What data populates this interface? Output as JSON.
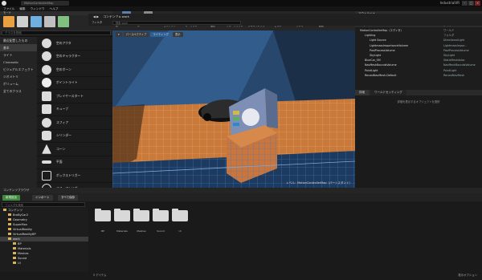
{
  "window": {
    "tab_label": "MotionControllerMap",
    "app_title": "IndustrialVR",
    "min_label": "–",
    "max_label": "□",
    "close_label": "×"
  },
  "menu": [
    "ファイル",
    "編集",
    "ウィンドウ",
    "ヘルプ"
  ],
  "modes": {
    "header": "モード",
    "search_placeholder": "クラスを検索",
    "colors": [
      "#e8a040",
      "#d0d0d0",
      "#6fb0e0",
      "#c0c0c0",
      "#80c080"
    ]
  },
  "place": {
    "categories": [
      {
        "label": "最近配置したもの",
        "selected": false
      },
      {
        "label": "基本",
        "selected": true
      },
      {
        "label": "ライト",
        "selected": false
      },
      {
        "label": "Cinematic",
        "selected": false
      },
      {
        "label": "ビジュアルエフェクト",
        "selected": false
      },
      {
        "label": "ジオメトリ",
        "selected": false
      },
      {
        "label": "ボリューム",
        "selected": false
      },
      {
        "label": "全てのクラス",
        "selected": false
      }
    ],
    "items": [
      {
        "label": "空のアクタ",
        "shape": "circle"
      },
      {
        "label": "空のキャラクター",
        "shape": "circle"
      },
      {
        "label": "空のポーン",
        "shape": "circle"
      },
      {
        "label": "ポイントライト",
        "shape": "circle"
      },
      {
        "label": "プレイヤースタート",
        "shape": "square"
      },
      {
        "label": "キューブ",
        "shape": "square"
      },
      {
        "label": "スフィア",
        "shape": "circle"
      },
      {
        "label": "シリンダー",
        "shape": "square"
      },
      {
        "label": "コーン",
        "shape": "square"
      },
      {
        "label": "平面",
        "shape": "square"
      },
      {
        "label": "ボックストリガー",
        "shape": "square"
      },
      {
        "label": "スフィアトリガー",
        "shape": "circle"
      }
    ]
  },
  "toolbar": [
    {
      "label": "現在のレベルを保存",
      "color": "#5a7fb0"
    },
    {
      "label": "ソースコントロール",
      "color": "#8a8a8a"
    },
    {
      "label": "コンテンツ",
      "color": "#5a7fb0"
    },
    {
      "label": "マーケット",
      "color": "#b07a30"
    },
    {
      "label": "設定",
      "color": "#8a8a8a"
    },
    {
      "label": "ブループリント",
      "color": "#4a78c0"
    },
    {
      "label": "シネマティクス",
      "color": "#707070"
    },
    {
      "label": "ビルド",
      "color": "#8a8a8a"
    },
    {
      "label": "プレイ",
      "color": "#3aa050"
    },
    {
      "label": "起動",
      "color": "#707070"
    }
  ],
  "viewport": {
    "perspective_label": "パースペクティブ",
    "lit_label": "ライティング",
    "show_label": "表示",
    "level_label": "レベル：MotionControllerMap（パーシスタント）"
  },
  "outliner": {
    "header": "アウトライナ",
    "search_placeholder": "検索",
    "col_label": "ラベル",
    "col_type": "タイプ",
    "rows": [
      {
        "name": "MotionControllerMap（エディタ）",
        "type": "ワールド",
        "selected": false,
        "indent": 0
      },
      {
        "name": "Lighting",
        "type": "フォルダ",
        "selected": false,
        "indent": 1
      },
      {
        "name": "Light Source",
        "type": "DirectionalLight",
        "selected": false,
        "indent": 2
      },
      {
        "name": "LightmassImportanceVolume",
        "type": "LightmassImpor...",
        "selected": false,
        "indent": 2
      },
      {
        "name": "PostProcessVolume",
        "type": "PostProcessVolume",
        "selected": false,
        "indent": 2
      },
      {
        "name": "SkyLight",
        "type": "SkyLight",
        "selected": false,
        "indent": 2
      },
      {
        "name": "BlueCar_SM",
        "type": "StaticMeshActor",
        "selected": false,
        "indent": 1
      },
      {
        "name": "NavMeshBoundsVolume",
        "type": "NavMeshBoundsVolume",
        "selected": false,
        "indent": 1
      },
      {
        "name": "PointLight",
        "type": "PointLight",
        "selected": false,
        "indent": 1
      },
      {
        "name": "RecastNavMesh-Default",
        "type": "RecastNavMesh",
        "selected": false,
        "indent": 1
      }
    ],
    "count_label": "26 アクタ",
    "view_options": "表示オプション"
  },
  "details": {
    "tab_details": "詳細",
    "tab_world": "ワールドセッティング",
    "message": "詳細を表示するオブジェクトを選択"
  },
  "content_browser": {
    "title": "コンテンツブラウザ",
    "add_new": "新規追加",
    "import": "インポート",
    "save_all": "すべて保存",
    "folder_search": "フォルダを検索",
    "path_root": "コンテンツ",
    "path_current": "work",
    "filter_label": "フィルタ",
    "search_assets": "検索 work",
    "tree": [
      {
        "label": "コンテンツ",
        "indent": 0,
        "selected": false
      },
      {
        "label": "BroByCar2",
        "indent": 1,
        "selected": false
      },
      {
        "label": "Geometry",
        "indent": 1,
        "selected": false
      },
      {
        "label": "SuperMax",
        "indent": 1,
        "selected": false
      },
      {
        "label": "VirtualReality",
        "indent": 1,
        "selected": false
      },
      {
        "label": "VirtualRealityBP",
        "indent": 1,
        "selected": false
      },
      {
        "label": "work",
        "indent": 1,
        "selected": true
      },
      {
        "label": "BP",
        "indent": 2,
        "selected": false
      },
      {
        "label": "Materials",
        "indent": 2,
        "selected": false
      },
      {
        "label": "Meshes",
        "indent": 2,
        "selected": false
      },
      {
        "label": "Sound",
        "indent": 2,
        "selected": false
      },
      {
        "label": "UI",
        "indent": 2,
        "selected": false
      }
    ],
    "assets": [
      "BP",
      "Materials",
      "Meshes",
      "Sound",
      "UI"
    ],
    "item_count": "5 アイテム",
    "view_options": "表示オプション"
  }
}
